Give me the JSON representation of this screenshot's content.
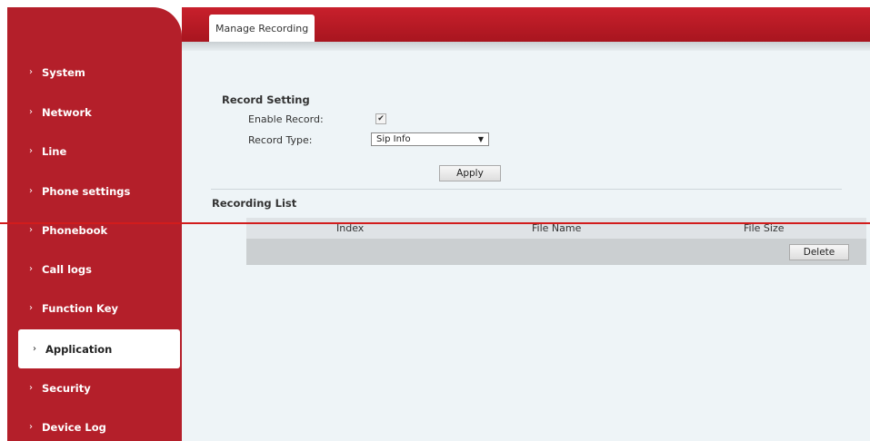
{
  "tab": {
    "label": "Manage Recording"
  },
  "sidebar": {
    "items": [
      {
        "label": "System"
      },
      {
        "label": "Network"
      },
      {
        "label": "Line"
      },
      {
        "label": "Phone settings"
      },
      {
        "label": "Phonebook"
      },
      {
        "label": "Call logs"
      },
      {
        "label": "Function Key"
      },
      {
        "label": "Application"
      },
      {
        "label": "Security"
      },
      {
        "label": "Device Log"
      }
    ],
    "active": "Application"
  },
  "record_setting": {
    "title": "Record Setting",
    "enable_label": "Enable Record:",
    "enable_checked": true,
    "type_label": "Record Type:",
    "type_value": "Sip Info",
    "apply_label": "Apply"
  },
  "recording_list": {
    "title": "Recording List",
    "columns": [
      "Index",
      "File Name",
      "File Size"
    ],
    "delete_label": "Delete"
  },
  "colors": {
    "accent": "#b41f2a",
    "content_bg": "#eef4f7"
  }
}
